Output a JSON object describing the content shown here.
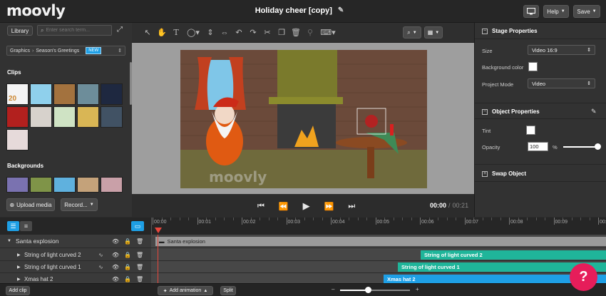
{
  "app": {
    "logo": "moovly",
    "project_title": "Holiday cheer [copy]"
  },
  "topbar": {
    "help_label": "Help",
    "save_label": "Save"
  },
  "library": {
    "tab_label": "Library",
    "search_placeholder": "Enter search term...",
    "breadcrumb_root": "Graphics",
    "breadcrumb_child": "Season's Greetings",
    "new_badge": "NEW",
    "clips_heading": "Clips",
    "backgrounds_heading": "Backgrounds",
    "upload_label": "Upload media",
    "record_label": "Record..."
  },
  "stage": {
    "watermark": "moovly"
  },
  "playback": {
    "current_time": "00:00",
    "separator": "/",
    "total_time": "00:21"
  },
  "stage_properties": {
    "title": "Stage Properties",
    "size_label": "Size",
    "size_value": "Video 16:9",
    "bg_color_label": "Background color",
    "project_mode_label": "Project Mode",
    "project_mode_value": "Video"
  },
  "object_properties": {
    "title": "Object Properties",
    "tint_label": "Tint",
    "opacity_label": "Opacity",
    "opacity_value": "100",
    "opacity_unit": "%",
    "opacity_fraction": 1.0
  },
  "swap_object": {
    "title": "Swap Object"
  },
  "timeline": {
    "ticks": [
      "00:00",
      "00:01",
      "00:02",
      "00:03",
      "00:04",
      "00:05",
      "00:06",
      "00:07",
      "00:08",
      "00:09",
      "00:10"
    ],
    "layers": [
      {
        "name": "Santa explosion",
        "bar_label": "Santa explosion"
      },
      {
        "name": "String of light curved 2",
        "bar_label": "String of light curved 2"
      },
      {
        "name": "String of light curved 1",
        "bar_label": "String of light curved 1"
      },
      {
        "name": "Xmas hat 2",
        "bar_label": "Xmas hat 2"
      }
    ]
  },
  "bottombar": {
    "add_clip_label": "Add clip",
    "add_animation_label": "Add animation",
    "split_label": "Split",
    "zoom_minus": "–",
    "zoom_plus": "+",
    "zoom_level": 0.4
  },
  "help_fab": {
    "label": "?"
  },
  "colors": {
    "accent_blue": "#1e9fe5",
    "teal": "#1fb59a",
    "help_pink": "#e61d5a",
    "playhead": "#e8463c",
    "new_badge": "#1e9fe5"
  }
}
